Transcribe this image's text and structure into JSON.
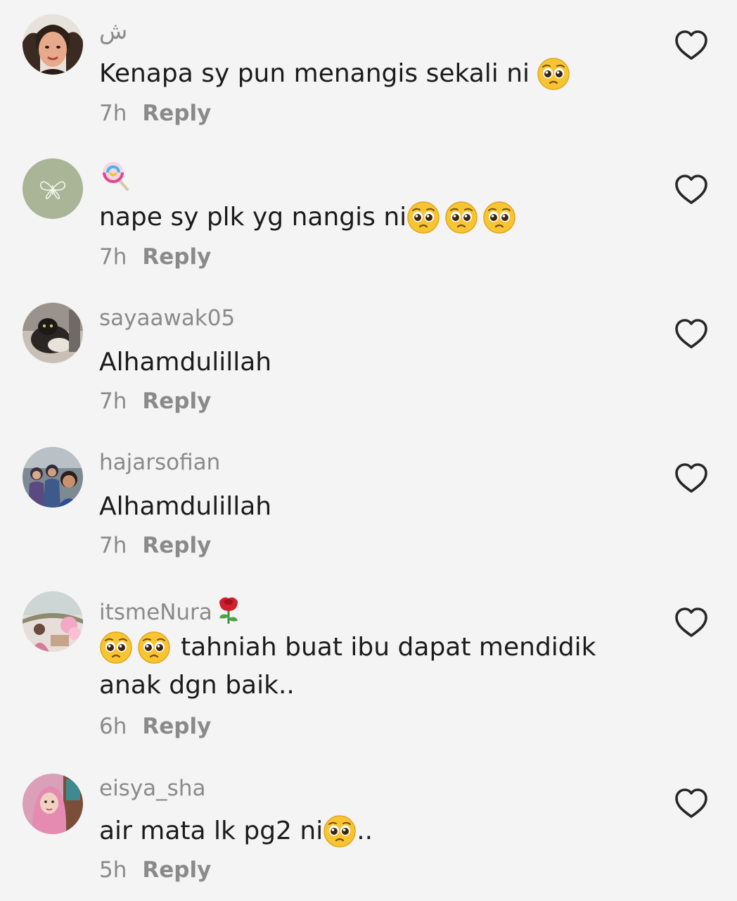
{
  "comments": [
    {
      "username": "ش",
      "text": "Kenapa sy pun menangis sekali ni",
      "time": "7h",
      "reply_label": "Reply"
    },
    {
      "username": "",
      "username_emoji": "lollipop-icon",
      "text": "nape sy plk yg nangis ni",
      "time": "7h",
      "reply_label": "Reply"
    },
    {
      "username": "sayaawak05",
      "text": "Alhamdulillah",
      "time": "7h",
      "reply_label": "Reply"
    },
    {
      "username": "hajarsofian",
      "text": "Alhamdulillah",
      "time": "7h",
      "reply_label": "Reply"
    },
    {
      "username": "itsmeNura",
      "username_emoji": "rose-icon",
      "text_line1": "tahniah buat ibu dapat mendidik",
      "text_line2": "anak dgn baik..",
      "time": "6h",
      "reply_label": "Reply"
    },
    {
      "username": "eisya_sha",
      "text": "air mata lk pg2 ni",
      "text_suffix": "..",
      "time": "5h",
      "reply_label": "Reply"
    }
  ],
  "icons": {
    "like": "heart-outline-icon",
    "emoji": "pleading-face-icon"
  },
  "colors": {
    "background": "#f4f4f4",
    "text": "#1b1b1b",
    "muted": "#8a8a8a",
    "heart_stroke": "#1f1f1f"
  }
}
